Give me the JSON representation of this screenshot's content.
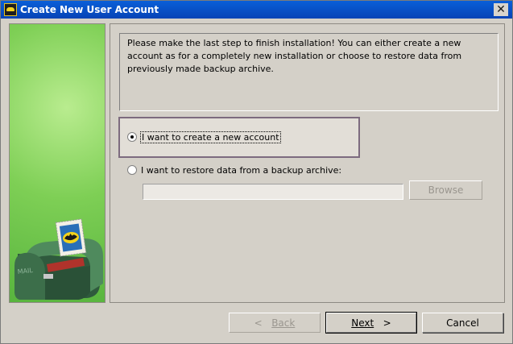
{
  "window": {
    "title": "Create New User Account",
    "close_glyph": "✕",
    "app_icon": "bat-icon"
  },
  "sidebar": {
    "illustration": "mailbox-with-bat-stamp",
    "mailbox_text": "MAIL"
  },
  "info": {
    "text": "Please make the last step to finish installation! You can either create a new account as for a completely new installation or choose to restore data from previously made backup archive."
  },
  "options": {
    "create_label": "I want to create a new account",
    "create_selected": true,
    "restore_label": "I want to restore data from a backup archive:",
    "restore_selected": false,
    "archive_path": "",
    "browse_label": "Browse"
  },
  "footer": {
    "back_label": "Back",
    "back_arrow": "<",
    "next_label": "Next",
    "next_arrow": ">",
    "cancel_label": "Cancel"
  },
  "colors": {
    "titlebar": "#0643b6",
    "sidebar_green": "#7ecf55",
    "window_bg": "#d4d0c8",
    "highlight_border": "#7d6b7f"
  }
}
